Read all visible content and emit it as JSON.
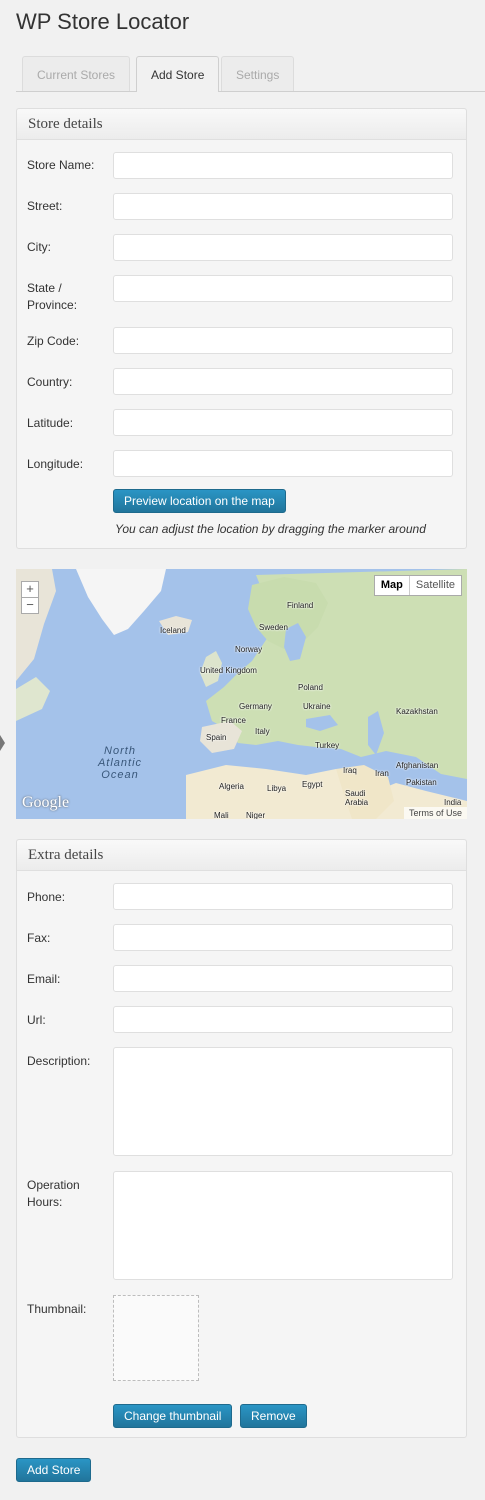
{
  "page": {
    "title": "WP Store Locator"
  },
  "tabs": [
    {
      "label": "Current Stores",
      "active": false
    },
    {
      "label": "Add Store",
      "active": true
    },
    {
      "label": "Settings",
      "active": false
    }
  ],
  "store_details": {
    "heading": "Store details",
    "fields": {
      "store_name": {
        "label": "Store Name:",
        "value": ""
      },
      "street": {
        "label": "Street:",
        "value": ""
      },
      "city": {
        "label": "City:",
        "value": ""
      },
      "state": {
        "label": "State / Province:",
        "value": ""
      },
      "zip": {
        "label": "Zip Code:",
        "value": ""
      },
      "country": {
        "label": "Country:",
        "value": ""
      },
      "latitude": {
        "label": "Latitude:",
        "value": ""
      },
      "longitude": {
        "label": "Longitude:",
        "value": ""
      }
    },
    "preview_button": "Preview location on the map",
    "hint": "You can adjust the location by dragging the marker around"
  },
  "map": {
    "zoom_in": "+",
    "zoom_out": "−",
    "map_type_map": "Map",
    "map_type_satellite": "Satellite",
    "logo": "Google",
    "terms": "Terms of Use",
    "ocean_label": "North Atlantic Ocean",
    "labels": {
      "finland": "Finland",
      "iceland": "Iceland",
      "sweden": "Sweden",
      "norway": "Norway",
      "uk": "United Kingdom",
      "poland": "Poland",
      "germany": "Germany",
      "ukraine": "Ukraine",
      "kazakhstan": "Kazakhstan",
      "france": "France",
      "italy": "Italy",
      "spain": "Spain",
      "turkey": "Turkey",
      "afghanistan": "Afghanistan",
      "iraq": "Iraq",
      "iran": "Iran",
      "pakistan": "Pakistan",
      "algeria": "Algeria",
      "libya": "Libya",
      "egypt": "Egypt",
      "saudi_arabia": "Saudi Arabia",
      "india": "India",
      "mali": "Mali",
      "niger": "Niger"
    },
    "colors": {
      "water": "#a4c2ea",
      "land": "#e8e4d8",
      "green": "#c8dcae",
      "ice": "#f5f5f5",
      "desert": "#f2ead2"
    }
  },
  "extra_details": {
    "heading": "Extra details",
    "fields": {
      "phone": {
        "label": "Phone:",
        "value": ""
      },
      "fax": {
        "label": "Fax:",
        "value": ""
      },
      "email": {
        "label": "Email:",
        "value": ""
      },
      "url": {
        "label": "Url:",
        "value": ""
      },
      "description": {
        "label": "Description:",
        "value": ""
      },
      "hours": {
        "label": "Operation Hours:",
        "value": ""
      },
      "thumbnail": {
        "label": "Thumbnail:"
      }
    },
    "change_thumbnail_button": "Change thumbnail",
    "remove_button": "Remove"
  },
  "submit_button": "Add Store",
  "colors": {
    "primary": "#21759b",
    "background": "#f1f1f1"
  }
}
